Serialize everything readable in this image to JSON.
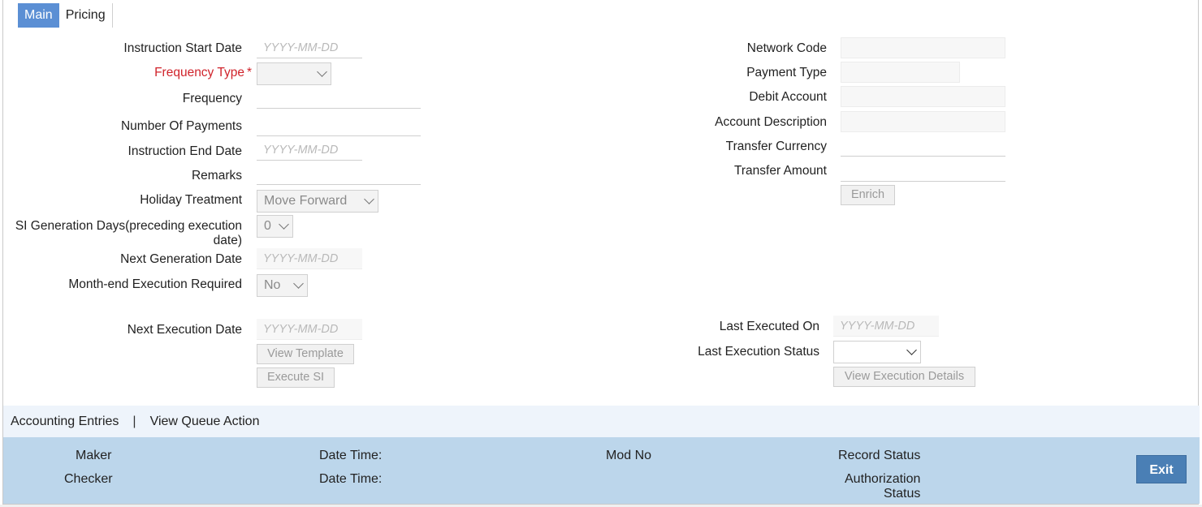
{
  "tabs": {
    "main": "Main",
    "pricing": "Pricing"
  },
  "left": {
    "instruction_start_date": {
      "label": "Instruction Start Date",
      "placeholder": "YYYY-MM-DD"
    },
    "frequency_type": {
      "label": "Frequency Type",
      "required_mark": "*",
      "value": ""
    },
    "frequency": {
      "label": "Frequency"
    },
    "number_of_payments": {
      "label": "Number Of Payments"
    },
    "instruction_end_date": {
      "label": "Instruction End Date",
      "placeholder": "YYYY-MM-DD"
    },
    "remarks": {
      "label": "Remarks"
    },
    "holiday_treatment": {
      "label": "Holiday Treatment",
      "value": "Move Forward"
    },
    "si_generation_days": {
      "label": "SI Generation Days(preceding execution date)",
      "value": "0"
    },
    "next_generation_date": {
      "label": "Next Generation Date",
      "placeholder": "YYYY-MM-DD"
    },
    "month_end_execution": {
      "label": "Month-end Execution Required",
      "value": "No"
    },
    "next_execution_date": {
      "label": "Next Execution Date",
      "placeholder": "YYYY-MM-DD"
    },
    "view_template": "View Template",
    "execute_si": "Execute SI"
  },
  "right": {
    "network_code": {
      "label": "Network Code"
    },
    "payment_type": {
      "label": "Payment Type"
    },
    "debit_account": {
      "label": "Debit Account"
    },
    "account_description": {
      "label": "Account Description"
    },
    "transfer_currency": {
      "label": "Transfer Currency"
    },
    "transfer_amount": {
      "label": "Transfer Amount"
    },
    "enrich": "Enrich",
    "last_executed_on": {
      "label": "Last Executed On",
      "placeholder": "YYYY-MM-DD"
    },
    "last_execution_status": {
      "label": "Last Execution Status",
      "value": ""
    },
    "view_execution_details": "View Execution Details"
  },
  "links": {
    "accounting_entries": "Accounting Entries",
    "separator": "|",
    "view_queue_action": "View Queue Action"
  },
  "footer": {
    "maker": "Maker",
    "checker": "Checker",
    "date_time_1": "Date Time:",
    "date_time_2": "Date Time:",
    "mod_no": "Mod No",
    "record_status": "Record Status",
    "authorization_status_1": "Authorization",
    "authorization_status_2": "Status",
    "exit": "Exit"
  },
  "colors": {
    "active_tab": "#5b8fd4",
    "required": "#d0232b",
    "footer_bg": "#bcd6eb",
    "exit_button": "#4a7fb5",
    "link_bar_bg": "#eef4fb"
  }
}
